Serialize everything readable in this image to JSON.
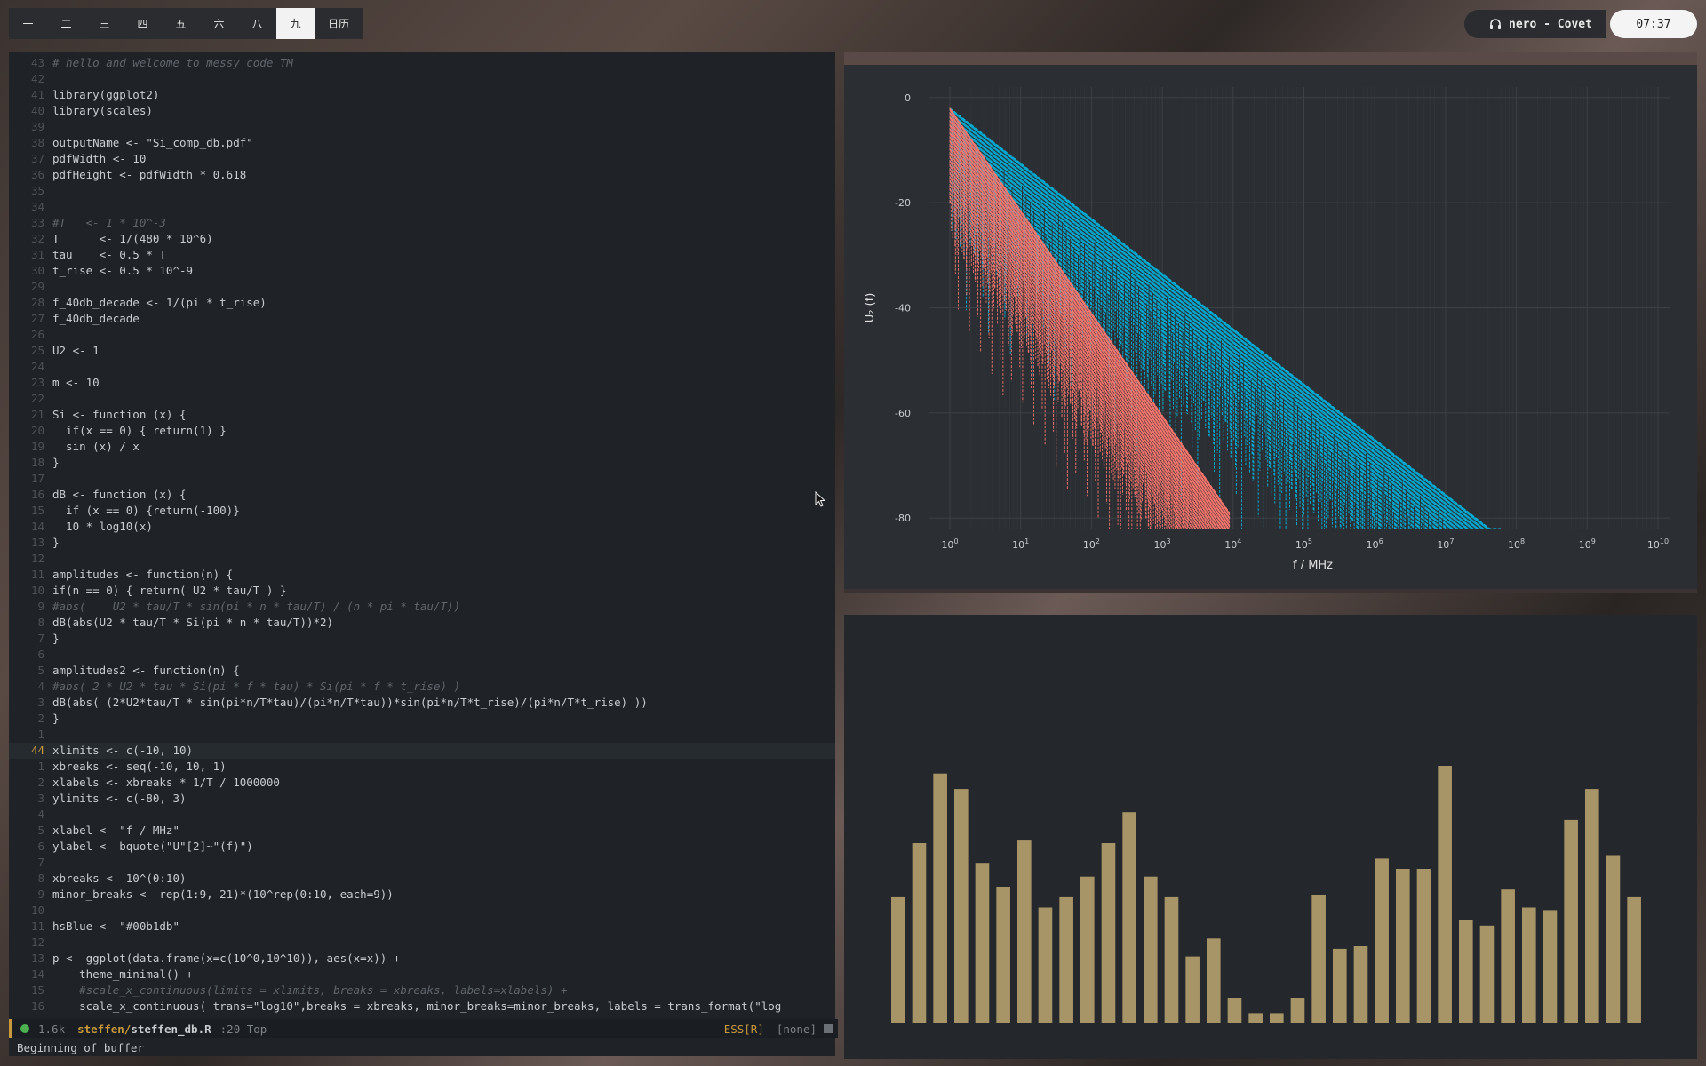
{
  "topbar": {
    "workspaces": [
      "一",
      "二",
      "三",
      "四",
      "五",
      "六",
      "八",
      "九",
      "日历"
    ],
    "active_workspace": "九",
    "music": "nero - Covet",
    "clock": "07:37"
  },
  "editor": {
    "lines": [
      {
        "n": "43",
        "t": "# hello and welcome to messy code TM",
        "c": "cm"
      },
      {
        "n": "42",
        "t": ""
      },
      {
        "n": "41",
        "t": "library(ggplot2)"
      },
      {
        "n": "40",
        "t": "library(scales)"
      },
      {
        "n": "39",
        "t": ""
      },
      {
        "n": "38",
        "t": "outputName <- \"Si_comp_db.pdf\""
      },
      {
        "n": "37",
        "t": "pdfWidth <- 10"
      },
      {
        "n": "36",
        "t": "pdfHeight <- pdfWidth * 0.618"
      },
      {
        "n": "35",
        "t": ""
      },
      {
        "n": "34",
        "t": ""
      },
      {
        "n": "33",
        "t": "#T   <- 1 * 10^-3",
        "c": "cm"
      },
      {
        "n": "32",
        "t": "T      <- 1/(480 * 10^6)"
      },
      {
        "n": "31",
        "t": "tau    <- 0.5 * T"
      },
      {
        "n": "30",
        "t": "t_rise <- 0.5 * 10^-9"
      },
      {
        "n": "29",
        "t": ""
      },
      {
        "n": "28",
        "t": "f_40db_decade <- 1/(pi * t_rise)"
      },
      {
        "n": "27",
        "t": "f_40db_decade"
      },
      {
        "n": "26",
        "t": ""
      },
      {
        "n": "25",
        "t": "U2 <- 1"
      },
      {
        "n": "24",
        "t": ""
      },
      {
        "n": "23",
        "t": "m <- 10"
      },
      {
        "n": "22",
        "t": ""
      },
      {
        "n": "21",
        "t": "Si <- function (x) {"
      },
      {
        "n": "20",
        "t": "  if(x == 0) { return(1) }"
      },
      {
        "n": "19",
        "t": "  sin (x) / x"
      },
      {
        "n": "18",
        "t": "}"
      },
      {
        "n": "17",
        "t": ""
      },
      {
        "n": "16",
        "t": "dB <- function (x) {"
      },
      {
        "n": "15",
        "t": "  if (x == 0) {return(-100)}"
      },
      {
        "n": "14",
        "t": "  10 * log10(x)"
      },
      {
        "n": "13",
        "t": "}"
      },
      {
        "n": "12",
        "t": ""
      },
      {
        "n": "11",
        "t": "amplitudes <- function(n) {"
      },
      {
        "n": "10",
        "t": "if(n == 0) { return( U2 * tau/T ) }"
      },
      {
        "n": "9",
        "t": "#abs(    U2 * tau/T * sin(pi * n * tau/T) / (n * pi * tau/T))",
        "c": "cm"
      },
      {
        "n": "8",
        "t": "dB(abs(U2 * tau/T * Si(pi * n * tau/T))*2)"
      },
      {
        "n": "7",
        "t": "}"
      },
      {
        "n": "6",
        "t": ""
      },
      {
        "n": "5",
        "t": "amplitudes2 <- function(n) {"
      },
      {
        "n": "4",
        "t": "#abs( 2 * U2 * tau * Si(pi * f * tau) * Si(pi * f * t_rise) )",
        "c": "cm"
      },
      {
        "n": "3",
        "t": "dB(abs( (2*U2*tau/T * sin(pi*n/T*tau)/(pi*n/T*tau))*sin(pi*n/T*t_rise)/(pi*n/T*t_rise) ))"
      },
      {
        "n": "2",
        "t": "}"
      },
      {
        "n": "1",
        "t": ""
      },
      {
        "n": "44",
        "t": "xlimits <- c(-10, 10)",
        "cur": true
      },
      {
        "n": "1",
        "t": "xbreaks <- seq(-10, 10, 1)"
      },
      {
        "n": "2",
        "t": "xlabels <- xbreaks * 1/T / 1000000"
      },
      {
        "n": "3",
        "t": "ylimits <- c(-80, 3)"
      },
      {
        "n": "4",
        "t": ""
      },
      {
        "n": "5",
        "t": "xlabel <- \"f / MHz\""
      },
      {
        "n": "6",
        "t": "ylabel <- bquote(\"U\"[2]~\"(f)\")"
      },
      {
        "n": "7",
        "t": ""
      },
      {
        "n": "8",
        "t": "xbreaks <- 10^(0:10)"
      },
      {
        "n": "9",
        "t": "minor_breaks <- rep(1:9, 21)*(10^rep(0:10, each=9))"
      },
      {
        "n": "10",
        "t": ""
      },
      {
        "n": "11",
        "t": "hsBlue <- \"#00b1db\""
      },
      {
        "n": "12",
        "t": ""
      },
      {
        "n": "13",
        "t": "p <- ggplot(data.frame(x=c(10^0,10^10)), aes(x=x)) +"
      },
      {
        "n": "14",
        "t": "    theme_minimal() +"
      },
      {
        "n": "15",
        "t": "    #scale_x_continuous(limits = xlimits, breaks = xbreaks, labels=xlabels) +",
        "c": "cm"
      },
      {
        "n": "16",
        "t": "    scale_x_continuous( trans=\"log10\",breaks = xbreaks, minor_breaks=minor_breaks, labels = trans_format(\"log"
      }
    ],
    "modeline": {
      "size": "1.6k",
      "dir": "steffen/",
      "file": "steffen_db.R",
      "pos": ":20 Top",
      "mode": "ESS[R]",
      "extra": "[none]"
    },
    "minibuffer": "Beginning of buffer"
  },
  "chart_data": [
    {
      "type": "scatter",
      "title": "",
      "xlabel": "f / MHz",
      "ylabel": "U₂ (f)",
      "x_scale": "log10",
      "xlim": [
        0.5,
        15000000000
      ],
      "ylim": [
        -82,
        2
      ],
      "x_ticks": [
        "10^0",
        "10^1",
        "10^2",
        "10^3",
        "10^4",
        "10^5",
        "10^6",
        "10^7",
        "10^8",
        "10^9",
        "10^10"
      ],
      "y_ticks": [
        0,
        -20,
        -40,
        -60,
        -80
      ],
      "grid": true,
      "series": [
        {
          "color": "#00b1db",
          "slope_db_per_decade": -10.5,
          "x_start": 1,
          "x_end": 60000000,
          "y_start": -2
        },
        {
          "color": "#f8766d",
          "slope_db_per_decade": -19.5,
          "x_start": 1,
          "x_end": 9000,
          "y_start": -2
        }
      ]
    },
    {
      "type": "bar",
      "color": "#a89567",
      "values": [
        0.49,
        0.7,
        0.97,
        0.91,
        0.62,
        0.53,
        0.71,
        0.45,
        0.49,
        0.57,
        0.7,
        0.82,
        0.57,
        0.49,
        0.26,
        0.33,
        0.1,
        0.04,
        0.04,
        0.1,
        0.5,
        0.29,
        0.3,
        0.64,
        0.6,
        0.6,
        1.0,
        0.4,
        0.38,
        0.52,
        0.45,
        0.44,
        0.79,
        0.91,
        0.65,
        0.49
      ]
    }
  ]
}
